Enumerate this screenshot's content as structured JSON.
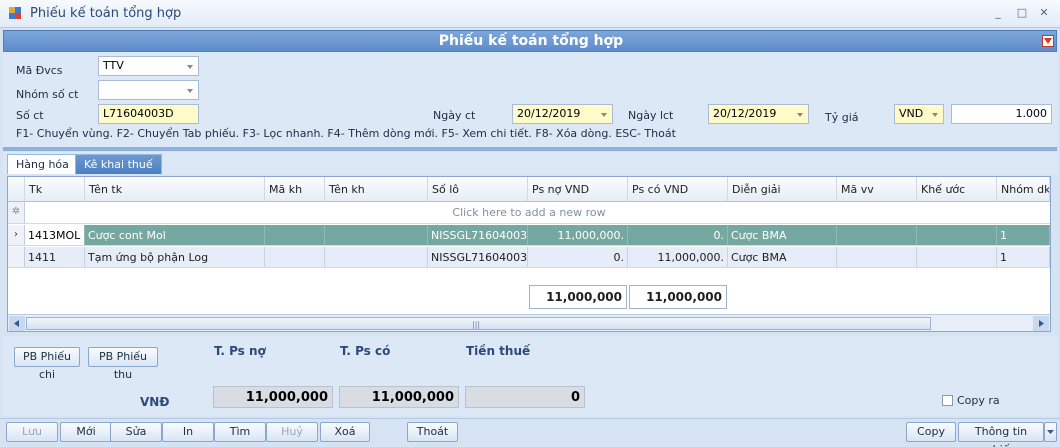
{
  "window": {
    "title": "Phiếu kế toán tổng hợp",
    "minimize": "_",
    "restore": "□",
    "close": "✕"
  },
  "header": {
    "title": "Phiếu kế toán tổng hợp"
  },
  "form": {
    "ma_dvcs_label": "Mã Đvcs",
    "ma_dvcs_value": "TTV",
    "nhom_so_ct_label": "Nhóm số ct",
    "nhom_so_ct_value": "",
    "so_ct_label": "Số ct",
    "so_ct_value": "L71604003D",
    "ngay_ct_label": "Ngày ct",
    "ngay_ct_value": "20/12/2019",
    "ngay_lct_label": "Ngày lct",
    "ngay_lct_value": "20/12/2019",
    "ty_gia_label": "Tỷ giá",
    "currency_value": "VND",
    "ty_gia_value": "1.000",
    "hint": "F1- Chuyển vùng. F2- Chuyển Tab phiếu. F3- Lọc nhanh. F4- Thêm dòng mới. F5- Xem chi tiết. F8- Xóa dòng. ESC- Thoát"
  },
  "tabs": [
    {
      "label": "Hàng hóa"
    },
    {
      "label": "Kê khai thuế"
    }
  ],
  "grid": {
    "columns": [
      "Tk",
      "Tên tk",
      "Mã kh",
      "Tên kh",
      "Số lô",
      "Ps nợ VND",
      "Ps có VND",
      "Diễn giải",
      "Mã vv",
      "Khế ước",
      "Nhóm dk"
    ],
    "new_row_text": "Click here to add a new row",
    "new_row_marker": "✲",
    "row_indicator": "›",
    "rows": [
      {
        "tk": "1413MOL",
        "ten_tk": "Cược cont Mol",
        "ma_kh": "",
        "ten_kh": "",
        "so_lo": "NISSGL71604003",
        "ps_no": "11,000,000.",
        "ps_co": "0.",
        "dien_giai": "Cược BMA",
        "ma_vv": "",
        "khe_uoc": "",
        "nhom_dk": "1"
      },
      {
        "tk": "1411",
        "ten_tk": "Tạm ứng  bộ phận Log",
        "ma_kh": "",
        "ten_kh": "",
        "so_lo": "NISSGL71604003",
        "ps_no": "0.",
        "ps_co": "11,000,000.",
        "dien_giai": "Cược BMA",
        "ma_vv": "",
        "khe_uoc": "",
        "nhom_dk": "1"
      }
    ],
    "total_no": "11,000,000",
    "total_co": "11,000,000",
    "scroll_grip": "|||"
  },
  "bottom": {
    "pb_phieu_chi": "PB Phiếu chi",
    "pb_phieu_thu": "PB Phiếu thu",
    "t_ps_no_label": "T. Ps nợ",
    "t_ps_co_label": "T. Ps có",
    "tien_thue_label": "Tiền thuế",
    "currency_label": "VNĐ",
    "t_ps_no_value": "11,000,000",
    "t_ps_co_value": "11,000,000",
    "tien_thue_value": "0",
    "copy_ra_label": "Copy ra"
  },
  "toolbar": {
    "luu": "Lưu",
    "moi": "Mới",
    "sua": "Sửa",
    "in": "In",
    "tim": "Tìm",
    "huy": "Huỷ",
    "xoa": "Xoá",
    "thoat": "Thoát",
    "copy": "Copy",
    "thong_tin_phieu": "Thông tin phiếu"
  }
}
